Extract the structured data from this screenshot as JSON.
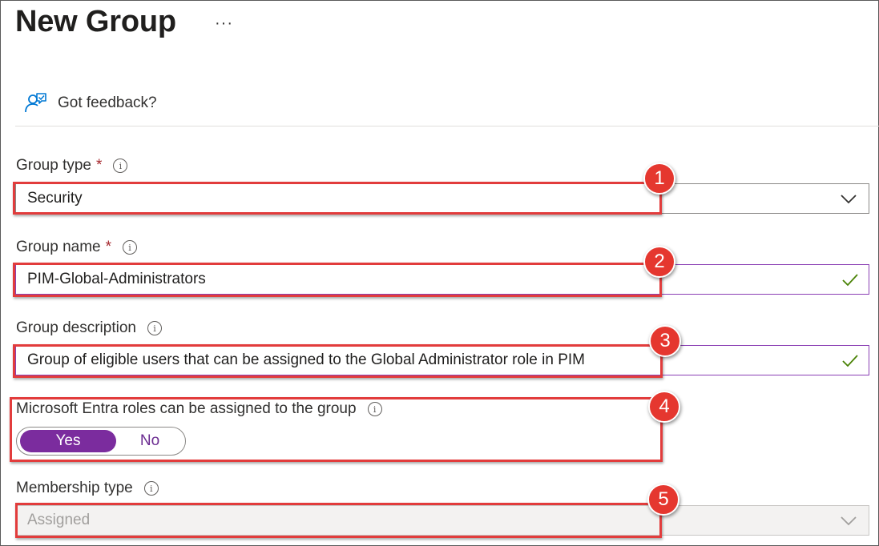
{
  "header": {
    "title": "New Group",
    "more_icon": "ellipsis-icon",
    "more_label": "···"
  },
  "feedback": {
    "icon": "feedback-person-icon",
    "label": "Got feedback?"
  },
  "form": {
    "group_type": {
      "label": "Group type",
      "required": "*",
      "value": "Security"
    },
    "group_name": {
      "label": "Group name",
      "required": "*",
      "value": "PIM-Global-Administrators"
    },
    "group_description": {
      "label": "Group description",
      "value": "Group of eligible users that can be assigned to the Global Administrator role in PIM"
    },
    "entra_roles": {
      "label": "Microsoft Entra roles can be assigned to the group",
      "yes_label": "Yes",
      "no_label": "No",
      "selected": "Yes"
    },
    "membership_type": {
      "label": "Membership type",
      "value": "Assigned"
    }
  },
  "callouts": [
    "1",
    "2",
    "3",
    "4",
    "5"
  ],
  "colors": {
    "accent_purple": "#7b2c9e",
    "callout_red": "#e5372f",
    "valid_check_green": "#498205",
    "required_red": "#a4262c"
  }
}
